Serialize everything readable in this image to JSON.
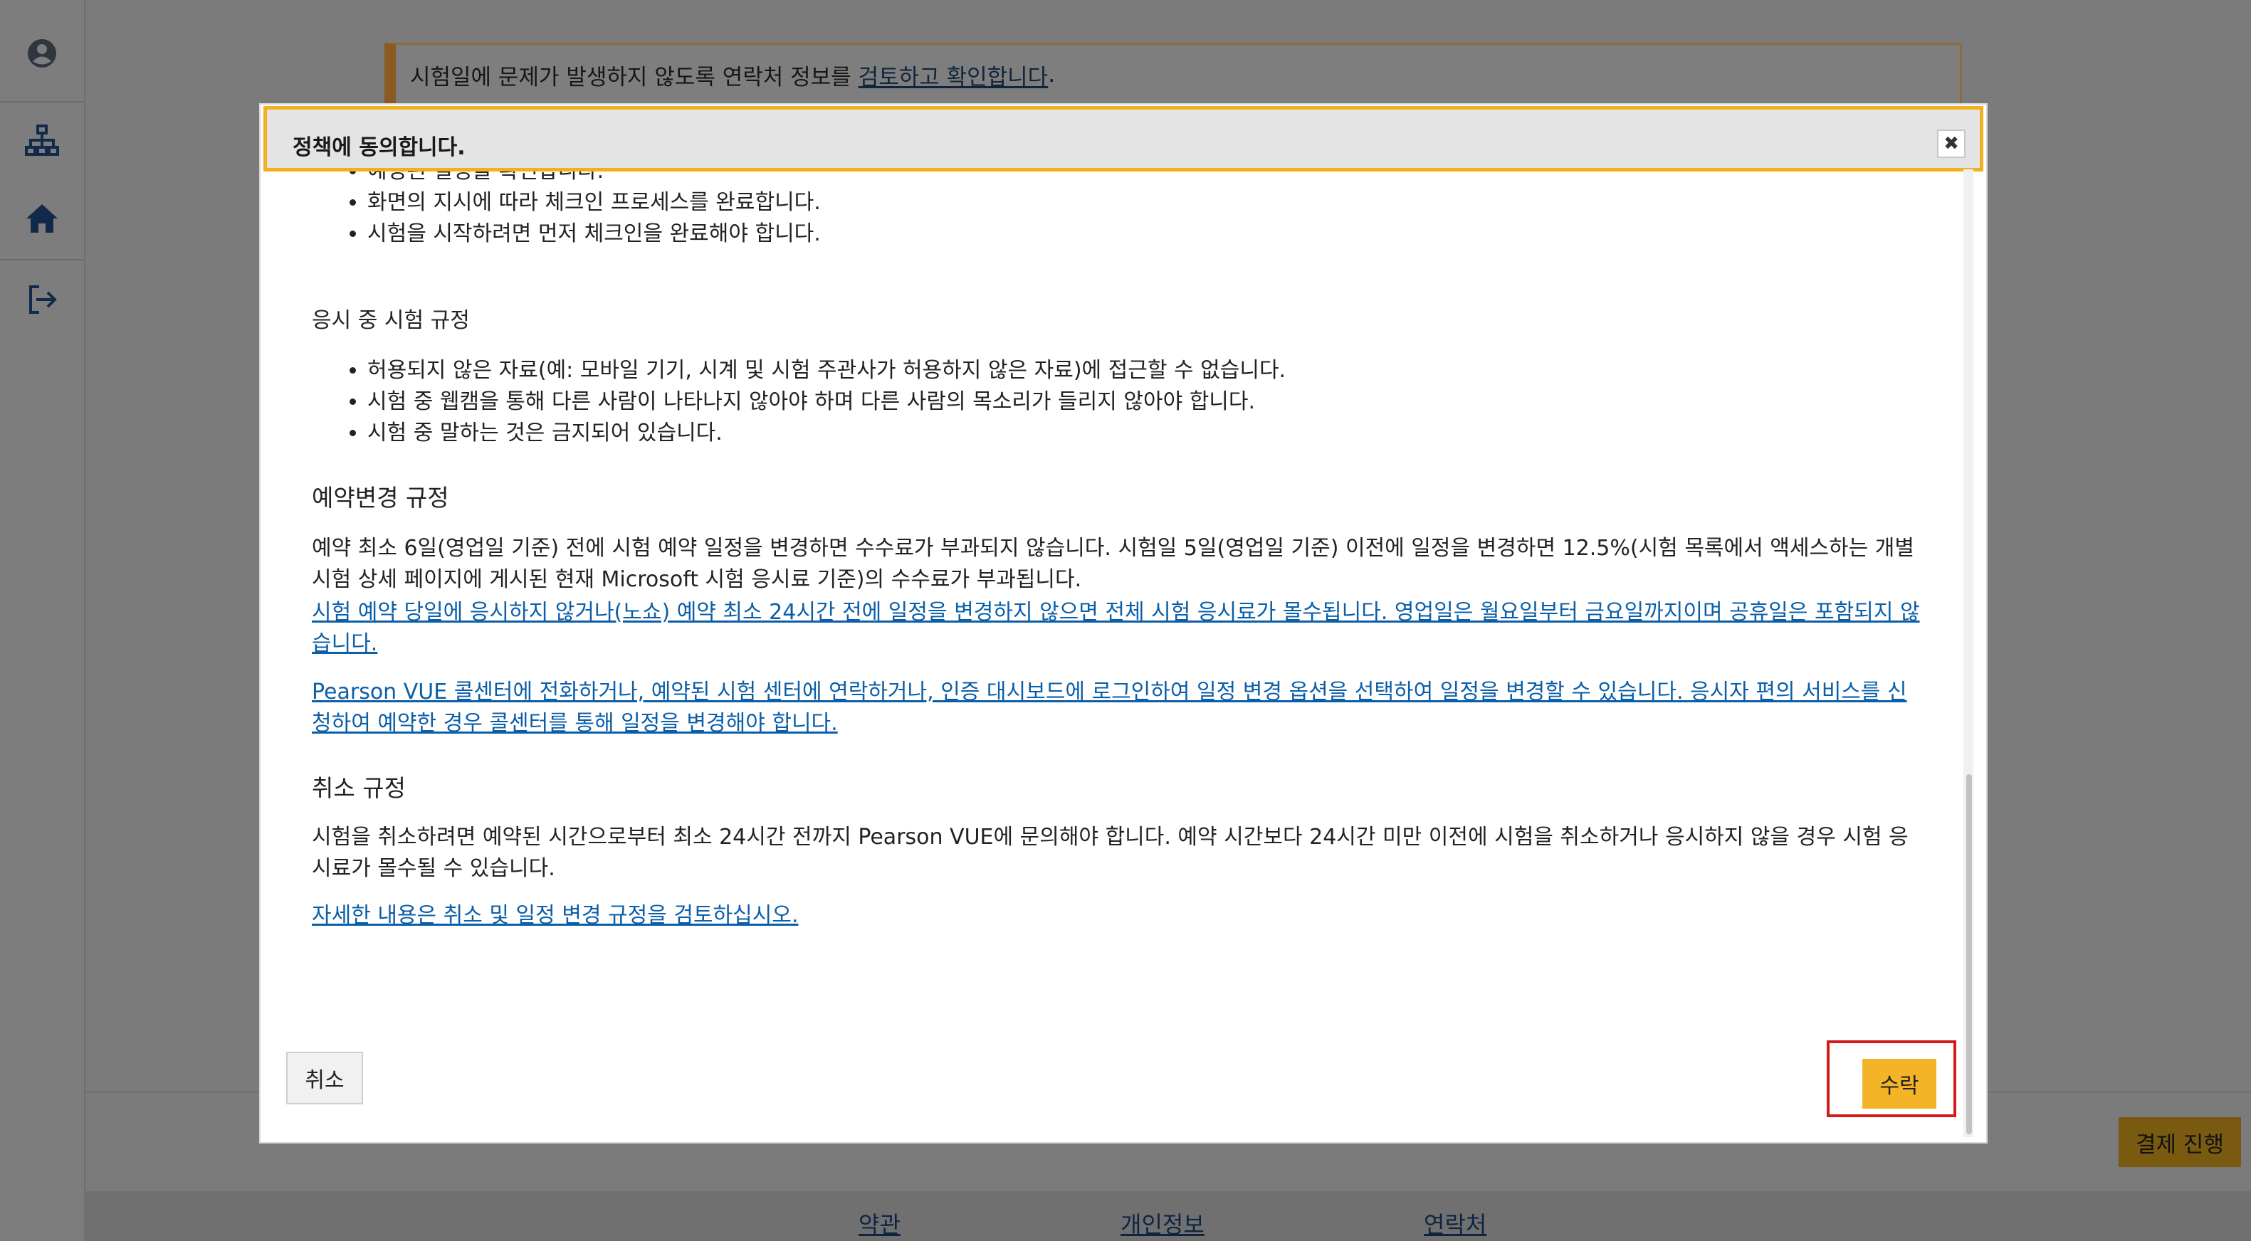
{
  "background": {
    "notice": {
      "text": "시험일에 문제가 발생하지 않도록 연락처 정보를",
      "link": "검토하고 확인합니다",
      "suffix": "."
    },
    "pay_button": "결제 진행",
    "footer": {
      "terms": "약관",
      "privacy": "개인정보",
      "contact": "연락처"
    },
    "sidebar_icons": [
      "user-icon",
      "sitemap-icon",
      "home-icon",
      "sign-out-icon"
    ]
  },
  "modal": {
    "title": "정책에 동의합니다.",
    "close_glyph": "✖",
    "checkin_bullets": [
      "예정된 일정을 확인합니다.",
      "화면의 지시에 따라 체크인 프로세스를 완료합니다.",
      "시험을 시작하려면 먼저 체크인을 완료해야 합니다."
    ],
    "exam_rules": {
      "heading": "응시 중 시험 규정",
      "bullets": [
        "허용되지 않은 자료(예: 모바일 기기, 시계 및 시험 주관사가 허용하지 않은 자료)에 접근할 수 없습니다.",
        "시험 중 웹캠을 통해 다른 사람이 나타나지 않아야 하며 다른 사람의 목소리가 들리지 않아야 합니다.",
        "시험 중 말하는 것은 금지되어 있습니다."
      ]
    },
    "reschedule": {
      "heading": "예약변경 규정",
      "paragraph": "예약 최소 6일(영업일 기준) 전에 시험 예약 일정을 변경하면 수수료가 부과되지 않습니다. 시험일 5일(영업일 기준) 이전에 일정을 변경하면 12.5%(시험 목록에서 액세스하는 개별 시험 상세 페이지에 게시된 현재 Microsoft 시험 응시료 기준)의 수수료가 부과됩니다.",
      "link1": "시험 예약 당일에 응시하지 않거나(노쇼) 예약 최소 24시간 전에 일정을 변경하지 않으면 전체 시험 응시료가 몰수됩니다. 영업일은 월요일부터 금요일까지이며 공휴일은 포함되지 않습니다.",
      "link2": "Pearson VUE 콜센터에 전화하거나, 예약된 시험 센터에 연락하거나, 인증 대시보드에 로그인하여 일정 변경 옵션을 선택하여 일정을 변경할 수 있습니다. 응시자 편의 서비스를 신청하여 예약한 경우 콜센터를 통해 일정을 변경해야 합니다."
    },
    "cancel_policy": {
      "heading": "취소 규정",
      "paragraph": "시험을 취소하려면 예약된 시간으로부터 최소 24시간 전까지 Pearson VUE에 문의해야 합니다. 예약 시간보다 24시간 미만 이전에 시험을 취소하거나 응시하지 않을 경우 시험 응시료가 몰수될 수 있습니다.",
      "link": "자세한 내용은 취소 및 일정 변경 규정을 검토하십시오."
    },
    "cancel_button": "취소",
    "accept_button": "수락"
  }
}
